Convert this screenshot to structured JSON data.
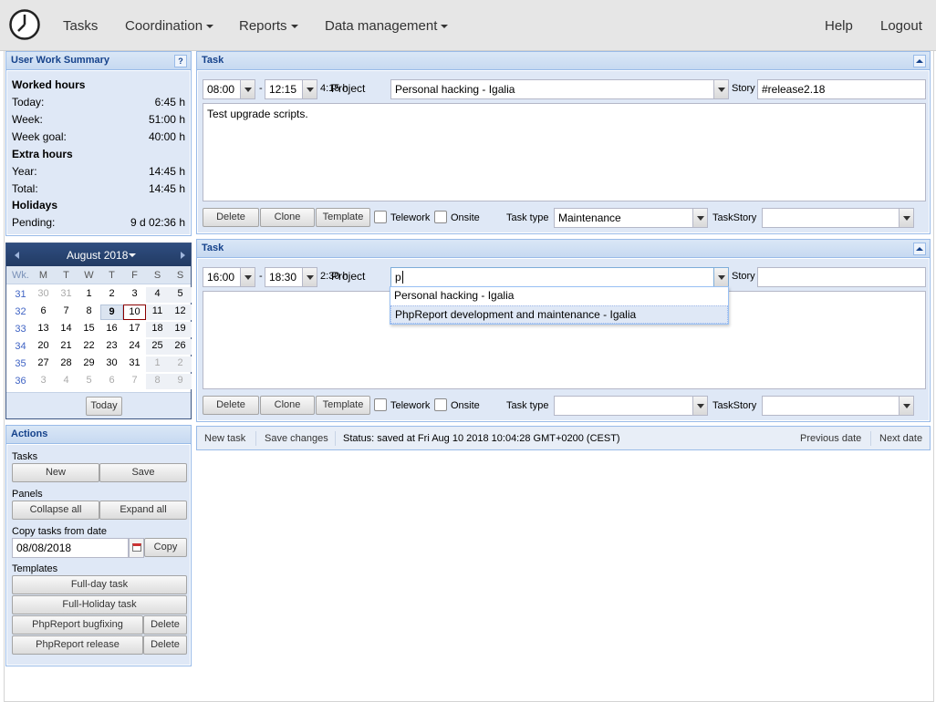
{
  "nav": {
    "tasks": "Tasks",
    "coordination": "Coordination",
    "reports": "Reports",
    "data_management": "Data management",
    "help": "Help",
    "logout": "Logout"
  },
  "summary": {
    "title": "User Work Summary",
    "help_icon": "?",
    "worked_hours": "Worked hours",
    "today_label": "Today:",
    "today_value": "6:45 h",
    "week_label": "Week:",
    "week_value": "51:00 h",
    "week_goal_label": "Week goal:",
    "week_goal_value": "40:00 h",
    "extra_hours": "Extra hours",
    "year_label": "Year:",
    "year_value": "14:45 h",
    "total_label": "Total:",
    "total_value": "14:45 h",
    "holidays": "Holidays",
    "pending_label": "Pending:",
    "pending_value": "9 d 02:36 h"
  },
  "calendar": {
    "month": "August 2018",
    "headers": [
      "Wk.",
      "M",
      "T",
      "W",
      "T",
      "F",
      "S",
      "S"
    ],
    "weeks": [
      {
        "wk": "31",
        "days": [
          "30",
          "31",
          "1",
          "2",
          "3",
          "4",
          "5"
        ]
      },
      {
        "wk": "32",
        "days": [
          "6",
          "7",
          "8",
          "9",
          "10",
          "11",
          "12"
        ]
      },
      {
        "wk": "33",
        "days": [
          "13",
          "14",
          "15",
          "16",
          "17",
          "18",
          "19"
        ]
      },
      {
        "wk": "34",
        "days": [
          "20",
          "21",
          "22",
          "23",
          "24",
          "25",
          "26"
        ]
      },
      {
        "wk": "35",
        "days": [
          "27",
          "28",
          "29",
          "30",
          "31",
          "1",
          "2"
        ]
      },
      {
        "wk": "36",
        "days": [
          "3",
          "4",
          "5",
          "6",
          "7",
          "8",
          "9"
        ]
      }
    ],
    "today_button": "Today"
  },
  "actions": {
    "title": "Actions",
    "tasks_label": "Tasks",
    "new": "New",
    "save": "Save",
    "panels_label": "Panels",
    "collapse_all": "Collapse all",
    "expand_all": "Expand all",
    "copy_label": "Copy tasks from date",
    "copy_date": "08/08/2018",
    "copy": "Copy",
    "templates_label": "Templates",
    "full_day": "Full-day task",
    "full_holiday": "Full-Holiday task",
    "tpl1": "PhpReport bugfixing",
    "tpl2": "PhpReport release",
    "delete": "Delete"
  },
  "task1": {
    "title": "Task",
    "start": "08:00",
    "dash": "-",
    "end": "12:15",
    "duration": "4:15 h",
    "project_label": "Project",
    "project": "Personal hacking - Igalia",
    "story_label": "Story",
    "story": "#release2.18",
    "description": "Test upgrade scripts.",
    "task_type_label": "Task type",
    "task_type": "Maintenance",
    "taskstory_label": "TaskStory",
    "taskstory": ""
  },
  "task2": {
    "title": "Task",
    "start": "16:00",
    "dash": "-",
    "end": "18:30",
    "duration": "2:30 h",
    "project_label": "Project",
    "project": "p",
    "story_label": "Story",
    "story": "",
    "description": "",
    "task_type_label": "Task type",
    "task_type": "",
    "taskstory_label": "TaskStory",
    "taskstory": ""
  },
  "task_buttons": {
    "delete": "Delete",
    "clone": "Clone",
    "template": "Template",
    "telework": "Telework",
    "onsite": "Onsite"
  },
  "dropdown": {
    "options": [
      "Personal hacking - Igalia",
      "PhpReport development and maintenance - Igalia"
    ]
  },
  "statusbar": {
    "new_task": "New task",
    "save_changes": "Save changes",
    "status": "Status: saved at Fri Aug 10 2018 10:04:28 GMT+0200 (CEST)",
    "previous_date": "Previous date",
    "next_date": "Next date"
  }
}
